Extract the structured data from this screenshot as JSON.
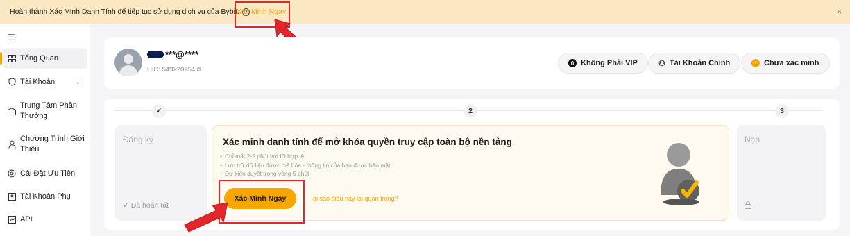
{
  "banner": {
    "text": "Hoàn thành Xác Minh Danh Tính để tiếp tục sử dụng dịch vụ của Bybit.",
    "help_icon": "?",
    "link": "Xác Minh Ngay",
    "close": "×"
  },
  "sidebar": {
    "toggle_icon": "☰",
    "items": [
      {
        "label": "Tổng Quan",
        "icon": "dashboard-icon"
      },
      {
        "label": "Tài Khoản",
        "icon": "shield-icon"
      },
      {
        "label": "Trung Tâm Phần Thưởng",
        "icon": "gift-icon"
      },
      {
        "label": "Chương Trình Giới Thiệu",
        "icon": "referral-icon"
      },
      {
        "label": "Cài Đặt Ưu Tiên",
        "icon": "settings-icon"
      },
      {
        "label": "Tài Khoản Phụ",
        "icon": "subaccount-icon"
      },
      {
        "label": "API",
        "icon": "api-icon"
      }
    ]
  },
  "profile": {
    "username": "***@****",
    "uid": "UID: 549220254"
  },
  "badges": {
    "vip": "Không Phải VIP",
    "main_account": "Tài Khoản Chính",
    "verify_status": "Chưa xác minh"
  },
  "steps": {
    "step1_icon": "✓",
    "step2": "2",
    "step3": "3",
    "register_title": "Đăng ký",
    "register_status": "Đã hoàn tất",
    "deposit_title": "Nạp"
  },
  "verify_card": {
    "title": "Xác minh danh tính để mở khóa quyền truy cập toàn bộ nền tảng",
    "bullets": [
      "Chỉ mất 2-5 phút với ID hợp lệ",
      "Lưu trữ dữ liệu được mã hóa - thông tin của bạn được bảo mật",
      "Dự kiến duyệt trong vòng 5 phút"
    ],
    "button": "Xác Minh Ngay",
    "why_link": "ại sao điều này lại quan trọng?"
  },
  "colors": {
    "accent": "#f7a600",
    "banner_bg": "#fbe8c2",
    "highlight_red": "#e3262b"
  }
}
